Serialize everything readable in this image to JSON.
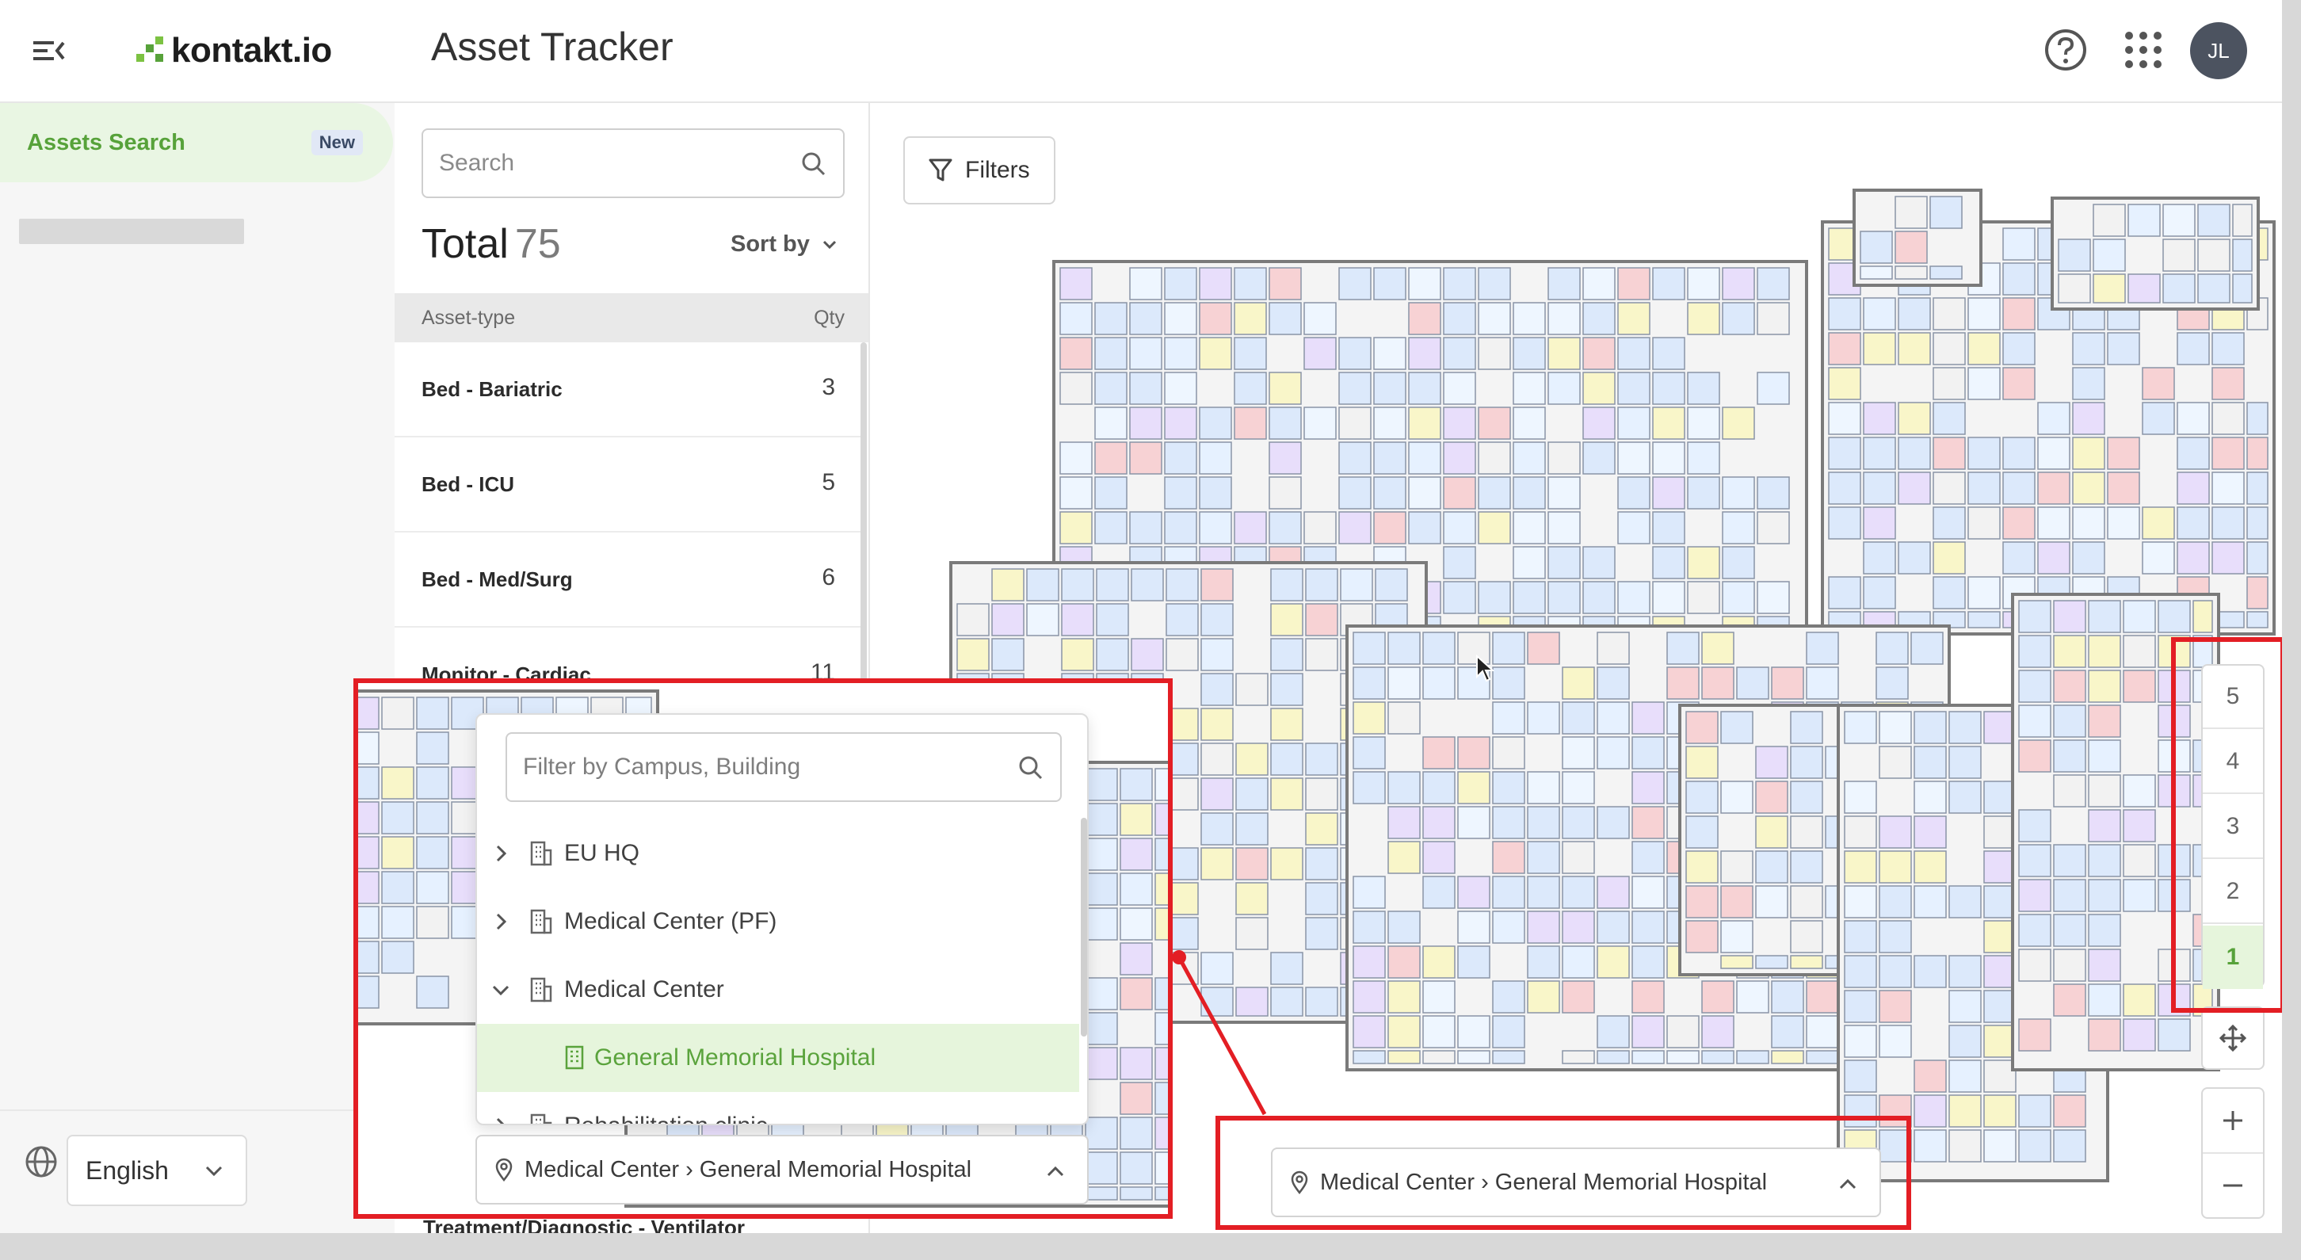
{
  "header": {
    "logo_text": "kontakt.io",
    "app_title": "Asset Tracker",
    "avatar_initials": "JL",
    "brand_color": "#57a23a"
  },
  "leftnav": {
    "active_item": "Assets Search",
    "active_badge": "New",
    "language": "English"
  },
  "panel": {
    "search_placeholder": "Search",
    "total_label": "Total",
    "total_value": "75",
    "sort_label": "Sort by",
    "columns": {
      "type": "Asset-type",
      "qty": "Qty"
    },
    "rows": [
      {
        "label": "Bed - Bariatric",
        "qty": "3"
      },
      {
        "label": "Bed - ICU",
        "qty": "5"
      },
      {
        "label": "Bed - Med/Surg",
        "qty": "6"
      },
      {
        "label": "Monitor - Cardiac",
        "qty": "11"
      }
    ],
    "cut_row_label": "Treatment/Diagnostic - Ventilator"
  },
  "map": {
    "filters_label": "Filters",
    "floors": [
      "5",
      "4",
      "3",
      "2",
      "1"
    ],
    "active_floor": "1",
    "location_label": "Medical Center › General Memorial Hospital"
  },
  "dropdown": {
    "search_placeholder": "Filter by Campus, Building",
    "items": [
      {
        "label": "EU HQ",
        "expanded": false
      },
      {
        "label": "Medical Center (PF)",
        "expanded": false
      },
      {
        "label": "Medical Center",
        "expanded": true
      },
      {
        "label": "General Memorial Hospital",
        "selected": true
      },
      {
        "label": "Rehabilitation clinic",
        "expanded": false
      }
    ],
    "location_label": "Medical Center › General Memorial Hospital"
  },
  "annotation_color": "#e31e24"
}
